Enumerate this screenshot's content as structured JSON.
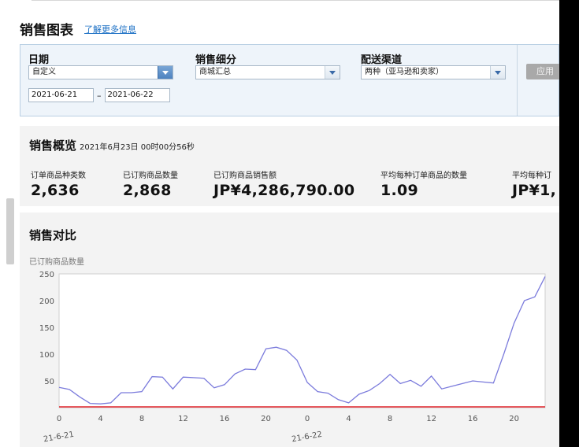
{
  "header": {
    "title": "销售图表",
    "info_link": "了解更多信息"
  },
  "filters": {
    "date": {
      "label": "日期",
      "range_value": "自定义",
      "start": "2021-06-21",
      "separator": "–",
      "end": "2021-06-22"
    },
    "breakdown": {
      "label": "销售细分",
      "value": "商城汇总"
    },
    "channel": {
      "label": "配送渠道",
      "value": "两种（亚马逊和卖家）"
    },
    "apply_label": "应用"
  },
  "overview": {
    "title": "销售概览",
    "timestamp": "2021年6月23日 00时00分56秒",
    "metrics": [
      {
        "label": "订单商品种类数",
        "value": "2,636"
      },
      {
        "label": "已订购商品数量",
        "value": "2,868"
      },
      {
        "label": "已订购商品销售额",
        "value": "JP¥4,286,790.00"
      },
      {
        "label": "平均每种订单商品的数量",
        "value": "1.09"
      },
      {
        "label": "平均每种订",
        "value": "JP¥1,"
      }
    ]
  },
  "compare": {
    "title": "销售对比"
  },
  "colors": {
    "accent": "#1a6fc4",
    "series": "#7b7bdc",
    "baseline": "#e0242a"
  },
  "icons": {
    "dropdown": "chevron-down-icon"
  },
  "chart_data": {
    "type": "line",
    "ylabel": "已订购商品数量",
    "ylim": [
      0,
      250
    ],
    "yticks": [
      50,
      100,
      150,
      200,
      250
    ],
    "x_tick_labels": [
      "0",
      "4",
      "8",
      "12",
      "16",
      "20",
      "0",
      "4",
      "8",
      "12",
      "16",
      "20"
    ],
    "date_labels": [
      "21-6-21",
      "21-6-22"
    ],
    "series": [
      {
        "values": [
          38,
          34,
          20,
          8,
          7,
          9,
          28,
          28,
          30,
          58,
          57,
          35,
          57,
          56,
          55,
          37,
          43,
          63,
          72,
          71,
          110,
          113,
          107,
          89,
          47,
          30,
          27,
          15,
          9,
          25,
          32,
          45,
          62,
          45,
          51,
          40,
          59,
          35,
          40,
          45,
          50,
          48,
          46,
          100,
          158,
          200,
          207,
          245
        ]
      },
      {
        "values": [
          0,
          0
        ]
      }
    ]
  }
}
